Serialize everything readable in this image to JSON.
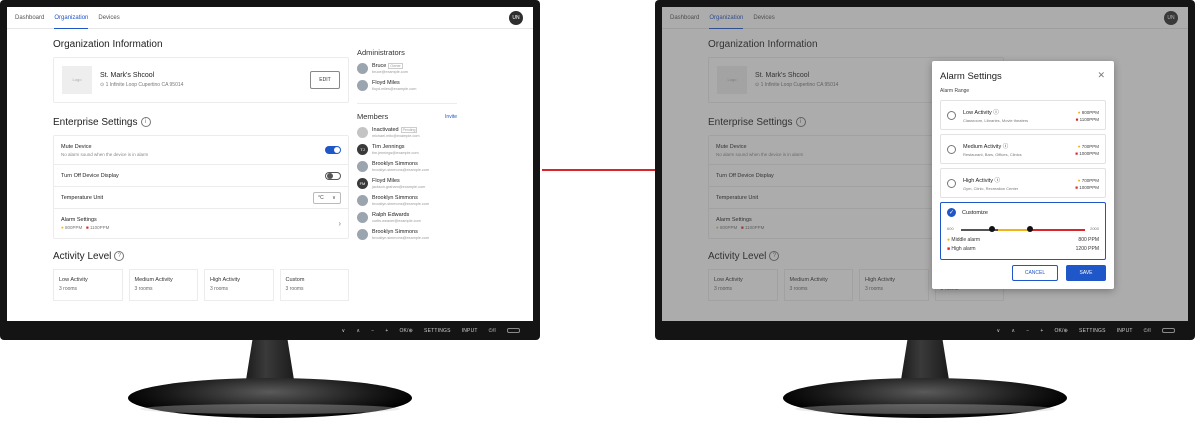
{
  "nav": {
    "tabs": [
      "Dashboard",
      "Organization",
      "Devices"
    ],
    "active": "Organization",
    "avatar": "UN"
  },
  "org": {
    "section_title": "Organization Information",
    "logo_label": "Logo",
    "name": "St. Mark's Shcool",
    "address": "1 Infinite Loop Cupertino CA 95014",
    "edit_label": "EDIT"
  },
  "enterprise": {
    "title": "Enterprise Settings",
    "mute_title": "Mute Device",
    "mute_sub": "No alarm sound when the device is in alarm",
    "mute_on": true,
    "display_title": "Turn Off Device Display",
    "display_on": false,
    "temp_title": "Temperature Unit",
    "temp_unit": "°C",
    "alarm_title": "Alarm Settings",
    "alarm_yellow": "800PPM",
    "alarm_red": "1100PPM"
  },
  "activity": {
    "title": "Activity Level",
    "cards": [
      {
        "name": "Low Activity",
        "rooms": "3 rooms"
      },
      {
        "name": "Medium Activity",
        "rooms": "3 rooms"
      },
      {
        "name": "High Activity",
        "rooms": "3 rooms"
      },
      {
        "name": "Custom",
        "rooms": "3 rooms"
      }
    ]
  },
  "admins": {
    "title": "Administrators",
    "list": [
      {
        "name": "Bruce",
        "tag": "Owner",
        "email": "bruce@example.com"
      },
      {
        "name": "Floyd Miles",
        "email": "floyd.miles@example.com"
      }
    ]
  },
  "members": {
    "title": "Members",
    "invite_label": "Invite",
    "list": [
      {
        "name": "Inactivated",
        "tag": "Pending",
        "email": "michael.mitc@example.com",
        "initials": ""
      },
      {
        "name": "Tim Jennings",
        "email": "tim.jennings@example.com",
        "initials": "TJ"
      },
      {
        "name": "Brooklyn Simmons",
        "email": "brooklyn.simmons@example.com",
        "initials": ""
      },
      {
        "name": "Floyd Miles",
        "email": "jackson.graham@example.com",
        "initials": "FM"
      },
      {
        "name": "Brooklyn Simmons",
        "email": "brooklyn.simmons@example.com",
        "initials": ""
      },
      {
        "name": "Ralph Edwards",
        "email": "curtis.weaver@example.com",
        "initials": ""
      },
      {
        "name": "Brooklyn Simmons",
        "email": "brooklyn.simmons@example.com",
        "initials": ""
      }
    ]
  },
  "modal": {
    "title": "Alarm Settings",
    "subtitle": "Alarm Range",
    "options": [
      {
        "name": "Low Activity",
        "desc": "Classroom, Libraries, Movie theaters",
        "yellow": "800PPM",
        "red": "1100PPM"
      },
      {
        "name": "Medium Activity",
        "desc": "Restaurant, Bars, Offices, Clinics",
        "yellow": "700PPM",
        "red": "1000PPM"
      },
      {
        "name": "High Activity",
        "desc": "Gym, Clinic, Recreation Center",
        "yellow": "700PPM",
        "red": "1000PPM"
      }
    ],
    "custom": {
      "name": "Customize",
      "min": "600",
      "max": "2000",
      "middle_label": "Middle alarm",
      "middle_value": "800 PPM",
      "high_label": "High alarm",
      "high_value": "1200 PPM"
    },
    "cancel_label": "CANCEL",
    "save_label": "SAVE"
  },
  "monitor": {
    "buttons": [
      "∨",
      "∧",
      "−",
      "+",
      "OK/⊕",
      "SETTINGS",
      "INPUT",
      "⏻/I"
    ]
  },
  "colors": {
    "primary": "#1f56c8",
    "warn_yellow": "#f2b31a",
    "alarm_red": "#d9262b",
    "arrow": "#d9262b"
  }
}
